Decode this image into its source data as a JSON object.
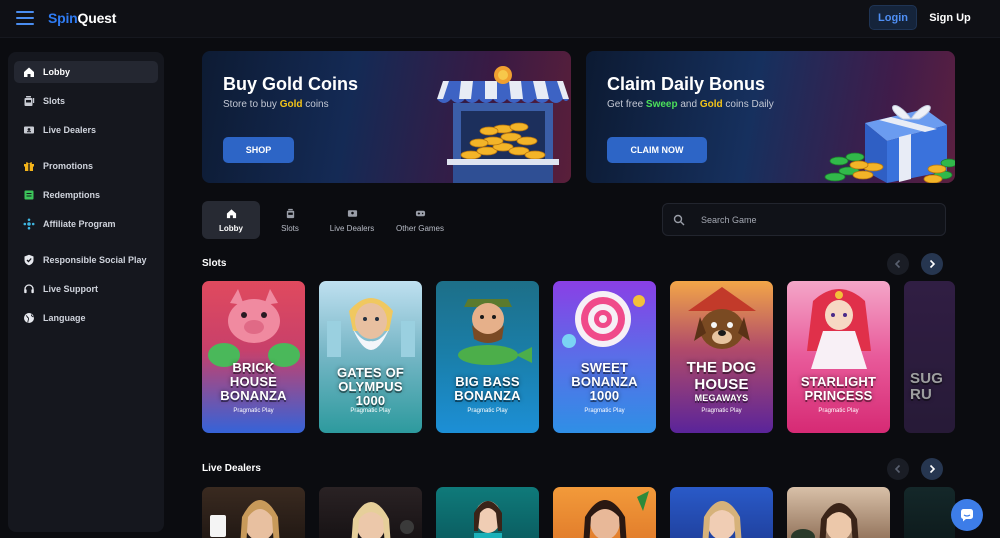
{
  "header": {
    "logo_part1": "Spin",
    "logo_part2": "Quest",
    "login_label": "Login",
    "signup_label": "Sign Up"
  },
  "sidebar": {
    "items": [
      {
        "label": "Lobby",
        "icon": "home-icon",
        "active": true
      },
      {
        "label": "Slots",
        "icon": "slot-machine-icon"
      },
      {
        "label": "Live Dealers",
        "icon": "live-dealer-icon"
      },
      {
        "label": "Promotions",
        "icon": "gift-icon"
      },
      {
        "label": "Redemptions",
        "icon": "redeem-icon"
      },
      {
        "label": "Affiliate Program",
        "icon": "affiliate-icon"
      },
      {
        "label": "Responsible Social Play",
        "icon": "shield-icon"
      },
      {
        "label": "Live Support",
        "icon": "headset-icon"
      },
      {
        "label": "Language",
        "icon": "globe-icon"
      }
    ]
  },
  "banners": {
    "gold": {
      "title": "Buy Gold Coins",
      "sub_prefix": "Store to buy ",
      "sub_highlight": "Gold",
      "sub_suffix": " coins",
      "button": "SHOP"
    },
    "bonus": {
      "title": "Claim Daily Bonus",
      "sub_prefix": "Get free ",
      "sub_highlight1": "Sweep",
      "sub_middle": " and ",
      "sub_highlight2": "Gold",
      "sub_suffix": " coins Daily",
      "button": "CLAIM NOW"
    }
  },
  "tabs": [
    {
      "label": "Lobby",
      "active": true
    },
    {
      "label": "Slots"
    },
    {
      "label": "Live Dealers"
    },
    {
      "label": "Other Games"
    }
  ],
  "search": {
    "placeholder": "Search Game"
  },
  "sections": {
    "slots_title": "Slots",
    "live_title": "Live Dealers"
  },
  "slots": [
    {
      "name": "BRICK HOUSE BONANZA",
      "lines": [
        "BRICK",
        "HOUSE",
        "BONANZA"
      ],
      "provider": "Pragmatic Play",
      "color_top": "#e94a6e",
      "color_bottom": "#3b6ee0"
    },
    {
      "name": "GATES OF OLYMPUS 1000",
      "lines": [
        "GATES OF",
        "OLYMPUS",
        "1000"
      ],
      "provider": "Pragmatic Play",
      "color_top": "#a8d3ea",
      "color_bottom": "#2fa3a6"
    },
    {
      "name": "BIG BASS BONANZA",
      "lines": [
        "BIG BASS",
        "BONANZA"
      ],
      "provider": "Pragmatic Play",
      "color_top": "#1b6f8a",
      "color_bottom": "#1a86c9"
    },
    {
      "name": "SWEET BONANZA 1000",
      "lines": [
        "SWEET",
        "BONANZA",
        "1000"
      ],
      "provider": "Pragmatic Play",
      "color_top": "#7a3fe0",
      "color_bottom": "#2f8fe6"
    },
    {
      "name": "THE DOG HOUSE MEGAWAYS",
      "lines": [
        "THE DOG",
        "HOUSE",
        "MEGAWAYS"
      ],
      "provider": "Pragmatic Play",
      "color_top": "#f0a040",
      "color_bottom": "#6a2aa0"
    },
    {
      "name": "STARLIGHT PRINCESS",
      "lines": [
        "STARLIGHT",
        "PRINCESS"
      ],
      "provider": "Pragmatic Play",
      "color_top": "#f07ab3",
      "color_bottom": "#e0347c"
    },
    {
      "name": "SUGAR RUSH",
      "lines": [
        "SUG",
        "RU"
      ],
      "provider": "",
      "color_top": "#4a2a66",
      "color_bottom": "#3a2a55"
    }
  ]
}
